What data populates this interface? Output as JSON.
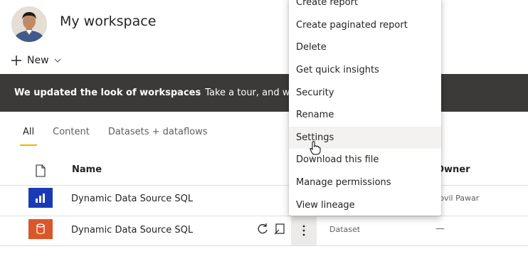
{
  "workspace": {
    "title": "My workspace"
  },
  "toolbar": {
    "new_label": "New"
  },
  "banner": {
    "strong_text": "We updated the look of workspaces",
    "tour_text": "Take a tour, and we'll"
  },
  "tabs": [
    {
      "label": "All",
      "active": true
    },
    {
      "label": "Content"
    },
    {
      "label": "Datasets + dataflows"
    }
  ],
  "table": {
    "headers": {
      "name": "Name",
      "owner": "Owner"
    },
    "rows": [
      {
        "name": "Dynamic Data Source SQL",
        "type": "",
        "owner": "Jovil Pawar",
        "icon": "report-icon",
        "icon_color": "#1a3bb5"
      },
      {
        "name": "Dynamic Data Source SQL",
        "type": "Dataset",
        "owner": "—",
        "icon": "dataset-icon",
        "icon_color": "#d9572a"
      }
    ]
  },
  "context_menu": {
    "items": [
      "Create report",
      "Create paginated report",
      "Delete",
      "Get quick insights",
      "Security",
      "Rename",
      "Settings",
      "Download this file",
      "Manage permissions",
      "View lineage"
    ],
    "hovered": "Settings"
  },
  "colors": {
    "banner_bg": "#3b3a39",
    "tab_underline": "#e8b800",
    "report_icon_bg": "#1a3bb5",
    "dataset_icon_bg": "#d9572a"
  }
}
